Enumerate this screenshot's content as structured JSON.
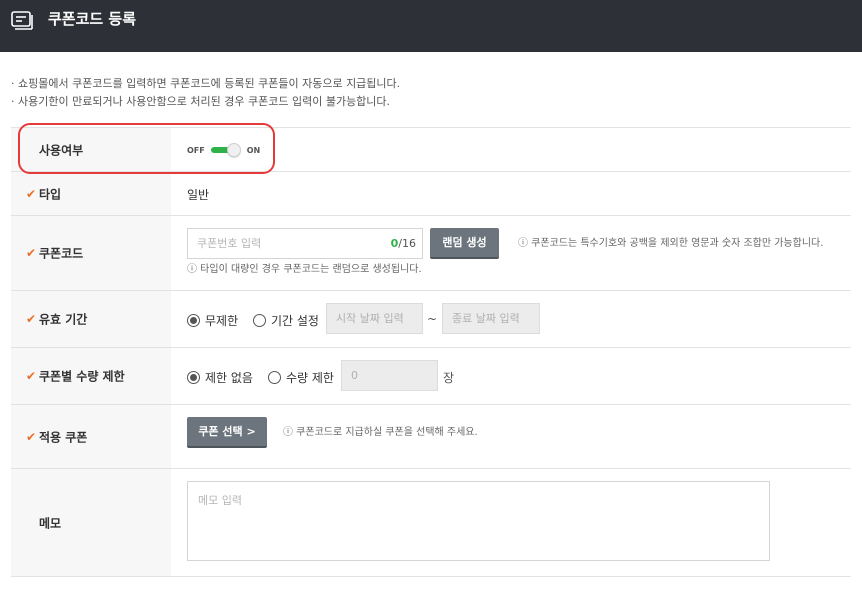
{
  "header": {
    "title": "쿠폰코드 등록",
    "icon": "coupon-list-icon"
  },
  "notices": [
    "· 쇼핑몰에서 쿠폰코드를 입력하면 쿠폰코드에 등록된 쿠폰들이 자동으로 지급됩니다.",
    "· 사용기한이 만료되거나 사용안함으로 처리된 경우 쿠폰코드 입력이 불가능합니다."
  ],
  "rows": {
    "use": {
      "label": "사용여부",
      "off": "OFF",
      "on": "ON",
      "state": "ON"
    },
    "type": {
      "label": "타입",
      "value": "일반"
    },
    "code": {
      "label": "쿠폰코드",
      "placeholder": "쿠폰번호 입력",
      "count_current": "0",
      "count_max": "/16",
      "random_button": "랜덤 생성",
      "help_right": "ⓘ 쿠폰코드는 특수기호와 공백을 제외한 영문과 숫자 조합만 가능합니다.",
      "help_below": "ⓘ 타입이 대량인 경우 쿠폰코드는 랜덤으로 생성됩니다."
    },
    "period": {
      "label": "유효 기간",
      "opt_unlimited": "무제한",
      "opt_set": "기간 설정",
      "start_placeholder": "시작 날짜 입력",
      "tilde": "~",
      "end_placeholder": "종료 날짜 입력"
    },
    "limit": {
      "label": "쿠폰별 수량 제한",
      "opt_none": "제한 없음",
      "opt_limit": "수량 제한",
      "qty_value": "0",
      "unit": "장"
    },
    "apply": {
      "label": "적용 쿠폰",
      "select_button": "쿠폰 선택 >",
      "help": "ⓘ 쿠폰코드로 지급하실 쿠폰을 선택해 주세요."
    },
    "memo": {
      "label": "메모",
      "placeholder": "메모 입력"
    }
  },
  "colors": {
    "header_bg": "#2d3036",
    "accent_green": "#2fb24a",
    "check_orange": "#e8702a",
    "highlight_red": "#e53a3a",
    "button_gray": "#6c757d"
  }
}
